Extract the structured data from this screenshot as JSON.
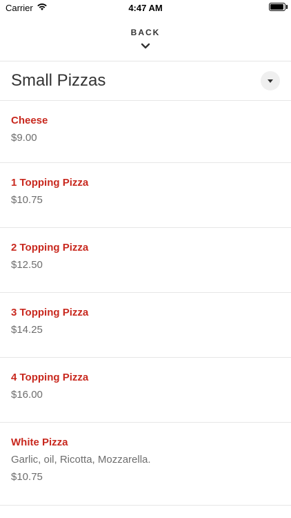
{
  "status_bar": {
    "carrier": "Carrier",
    "time": "4:47 AM",
    "icons": [
      "wifi-icon",
      "battery-icon"
    ]
  },
  "nav": {
    "back_label": "BACK",
    "back_icon": "chevron-down-icon"
  },
  "section": {
    "title": "Small Pizzas",
    "toggle_icon": "caret-down-icon"
  },
  "items": [
    {
      "name": "Cheese",
      "description": "",
      "price": "$9.00"
    },
    {
      "name": "1 Topping Pizza",
      "description": "",
      "price": "$10.75"
    },
    {
      "name": "2 Topping Pizza",
      "description": "",
      "price": "$12.50"
    },
    {
      "name": "3 Topping Pizza",
      "description": "",
      "price": "$14.25"
    },
    {
      "name": "4 Topping Pizza",
      "description": "",
      "price": "$16.00"
    },
    {
      "name": "White Pizza",
      "description": "Garlic, oil, Ricotta, Mozzarella.",
      "price": "$10.75"
    }
  ],
  "colors": {
    "accent": "#c8281e",
    "muted_text": "#6d6d6d",
    "divider": "#e6e6e6"
  }
}
